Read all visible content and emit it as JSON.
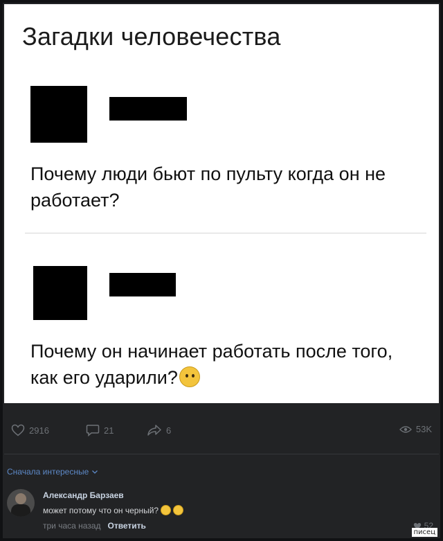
{
  "post": {
    "title": "Загадки человечества",
    "question_1": "Почему люди бьют по пульту когда он не работает?",
    "question_2": "Почему он начинает работать после того, как его ударили?"
  },
  "actions": {
    "likes": "2916",
    "comments": "21",
    "shares": "6",
    "views": "53K"
  },
  "sort": {
    "label": "Сначала интересные"
  },
  "comment": {
    "author": "Александр Барзаев",
    "text": "может потому что он черный?",
    "time": "три часа назад",
    "reply_label": "Ответить",
    "likes": "52"
  },
  "watermark": "писец",
  "icons": {
    "like": "heart-icon",
    "comment": "comment-icon",
    "share": "share-arrow-icon",
    "views": "eye-icon",
    "sort": "chevron-down-icon"
  },
  "colors": {
    "background": "#222325",
    "link": "#5d89c7",
    "muted": "#6e7277"
  }
}
